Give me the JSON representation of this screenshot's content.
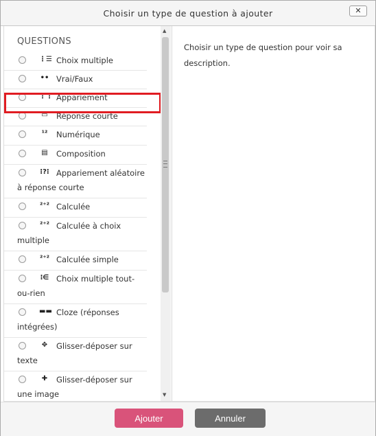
{
  "dialog": {
    "title": "Choisir un type de question à ajouter",
    "close_label": "✕"
  },
  "section_title": "QUESTIONS",
  "items": [
    {
      "label": "Choix multiple",
      "icon": "list-bullets-icon",
      "glyph": "⋮☰"
    },
    {
      "label": "Vrai/Faux",
      "icon": "two-dots-icon",
      "glyph": "••"
    },
    {
      "label": "Appariement",
      "icon": "match-lines-icon",
      "glyph": "⋮⋮"
    },
    {
      "label": "Réponse courte",
      "icon": "text-box-icon",
      "glyph": "▭"
    },
    {
      "label": "Numérique",
      "icon": "numeric-icon",
      "glyph": "¹²"
    },
    {
      "label": "Composition",
      "icon": "document-icon",
      "glyph": "▤"
    },
    {
      "label": "Appariement aléatoire à réponse courte",
      "icon": "random-match-icon",
      "glyph": "⁝?⁝"
    },
    {
      "label": "Calculée",
      "icon": "calculated-icon",
      "glyph": "²⁺²"
    },
    {
      "label": "Calculée à choix multiple",
      "icon": "calculated-multi-icon",
      "glyph": "²⁺²"
    },
    {
      "label": "Calculée simple",
      "icon": "calculated-simple-icon",
      "glyph": "²⁺²"
    },
    {
      "label": "Choix multiple tout-ou-rien",
      "icon": "all-or-nothing-icon",
      "glyph": "⁝∈"
    },
    {
      "label": "Cloze (réponses intégrées)",
      "icon": "cloze-icon",
      "glyph": "▬▬"
    },
    {
      "label": "Glisser-déposer sur texte",
      "icon": "move-arrows-icon",
      "glyph": "✥"
    },
    {
      "label": "Glisser-déposer sur une image",
      "icon": "move-cross-icon",
      "glyph": "✚"
    }
  ],
  "description": "Choisir un type de question pour voir sa description.",
  "buttons": {
    "add": "Ajouter",
    "cancel": "Annuler"
  },
  "colors": {
    "add_button": "#d9537a",
    "cancel_button": "#6c6c6c",
    "highlight": "#e01c22"
  }
}
